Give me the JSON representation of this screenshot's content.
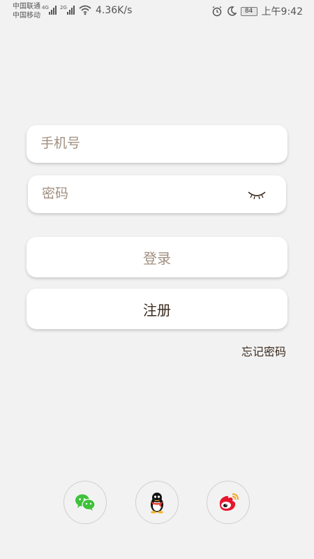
{
  "statusbar": {
    "carrier1": "中国联通",
    "carrier2": "中国移动",
    "net1": "4G",
    "net2": "2G",
    "speed": "4.36K/s",
    "battery": "84",
    "time": "上午9:42"
  },
  "form": {
    "phone_placeholder": "手机号",
    "password_placeholder": "密码",
    "login_label": "登录",
    "register_label": "注册",
    "forgot_label": "忘记密码"
  },
  "social": {
    "wechat_icon": "wechat-icon",
    "qq_icon": "qq-icon",
    "weibo_icon": "weibo-icon"
  },
  "colors": {
    "background": "#f2f2f2",
    "text_dark": "#3a2a1e",
    "placeholder": "#a08f80"
  }
}
